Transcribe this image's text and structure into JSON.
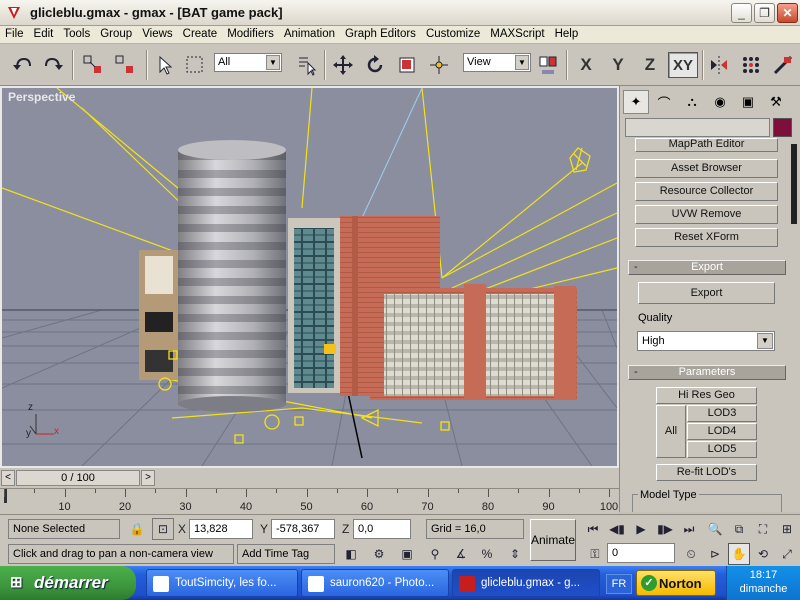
{
  "window": {
    "title": "glicleblu.gmax - gmax - [BAT game pack]",
    "minimize_icon": "minimize-icon",
    "restore_icon": "restore-icon",
    "close_icon": "close-icon"
  },
  "menu": [
    "File",
    "Edit",
    "Tools",
    "Group",
    "Views",
    "Create",
    "Modifiers",
    "Animation",
    "Graph Editors",
    "Customize",
    "MAXScript",
    "Help"
  ],
  "toolbar": {
    "selection_filter": "All",
    "reference_coord": "View",
    "axis_x": "X",
    "axis_y": "Y",
    "axis_z": "Z",
    "axis_xy": "XY"
  },
  "viewport": {
    "label": "Perspective",
    "axis_x": "x",
    "axis_y": "y",
    "axis_z": "z"
  },
  "command_panel": {
    "buttons_top": [
      "MapPath Editor",
      "Asset Browser",
      "Resource Collector",
      "UVW Remove",
      "Reset XForm"
    ],
    "export": {
      "header": "Export",
      "collapse": "-",
      "button": "Export",
      "quality_label": "Quality",
      "quality_value": "High"
    },
    "parameters": {
      "header": "Parameters",
      "collapse": "-",
      "hi_res_geo": "Hi Res Geo",
      "all": "All",
      "lods": [
        "LOD3",
        "LOD4",
        "LOD5"
      ],
      "refit": "Re-fit LOD's",
      "model_type": "Model Type"
    },
    "accent_color": "#7d0f3a"
  },
  "timeline": {
    "frame_label": "0 / 100",
    "prev": "<",
    "next": ">",
    "ticks": [
      "10",
      "20",
      "30",
      "40",
      "50",
      "60",
      "70",
      "80",
      "90",
      "100"
    ]
  },
  "status": {
    "selection": "None Selected",
    "x_label": "X",
    "x_value": "13,828",
    "y_label": "Y",
    "y_value": "-578,367",
    "z_label": "Z",
    "z_value": "0,0",
    "grid": "Grid = 16,0",
    "animate": "Animate",
    "prompt": "Click and drag to pan a non-camera view",
    "add_time_tag": "Add Time Tag",
    "frame_value": "0"
  },
  "taskbar": {
    "start": "démarrer",
    "tasks": [
      "ToutSimcity, les fo...",
      "sauron620 - Photo...",
      "glicleblu.gmax - g..."
    ],
    "lang": "FR",
    "norton": "Norton",
    "time": "18:17",
    "day": "dimanche"
  }
}
